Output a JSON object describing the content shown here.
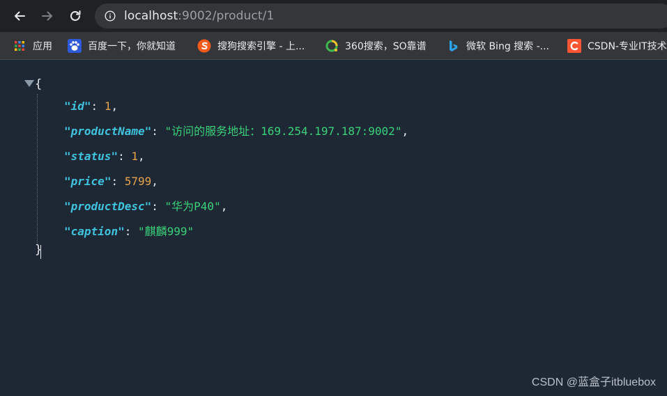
{
  "browser": {
    "url_host": "localhost",
    "url_path": ":9002/product/1",
    "icons": {
      "back": "arrow-left-icon",
      "forward": "arrow-right-icon",
      "reload": "reload-icon",
      "info": "info-icon"
    }
  },
  "bookmarks": [
    {
      "label": "应用",
      "icon": "apps-grid-icon"
    },
    {
      "label": "百度一下，你就知道",
      "icon": "baidu-paw-icon"
    },
    {
      "label": "搜狗搜索引擎 - 上...",
      "icon": "sogou-icon"
    },
    {
      "label": "360搜索，SO靠谱",
      "icon": "360-icon"
    },
    {
      "label": "微软 Bing 搜索 -...",
      "icon": "bing-icon"
    },
    {
      "label": "CSDN-专业IT技术",
      "icon": "csdn-icon"
    }
  ],
  "json": {
    "open_brace": "{",
    "close_brace": "}",
    "entries": [
      {
        "key": "id",
        "value": "1",
        "kind": "number",
        "comma": ","
      },
      {
        "key": "productName",
        "value": "访问的服务地址：169.254.197.187:9002",
        "kind": "string",
        "comma": ","
      },
      {
        "key": "status",
        "value": "1",
        "kind": "number",
        "comma": ","
      },
      {
        "key": "price",
        "value": "5799",
        "kind": "number",
        "comma": ","
      },
      {
        "key": "productDesc",
        "value": "华为P40",
        "kind": "string",
        "comma": ","
      },
      {
        "key": "caption",
        "value": "麒麟999",
        "kind": "string",
        "comma": ""
      }
    ]
  },
  "watermark": "CSDN @蓝盒子itbluebox",
  "colors": {
    "background": "#1e2834",
    "key": "#3fc3df",
    "number": "#e8a24c",
    "string": "#39d27a"
  }
}
